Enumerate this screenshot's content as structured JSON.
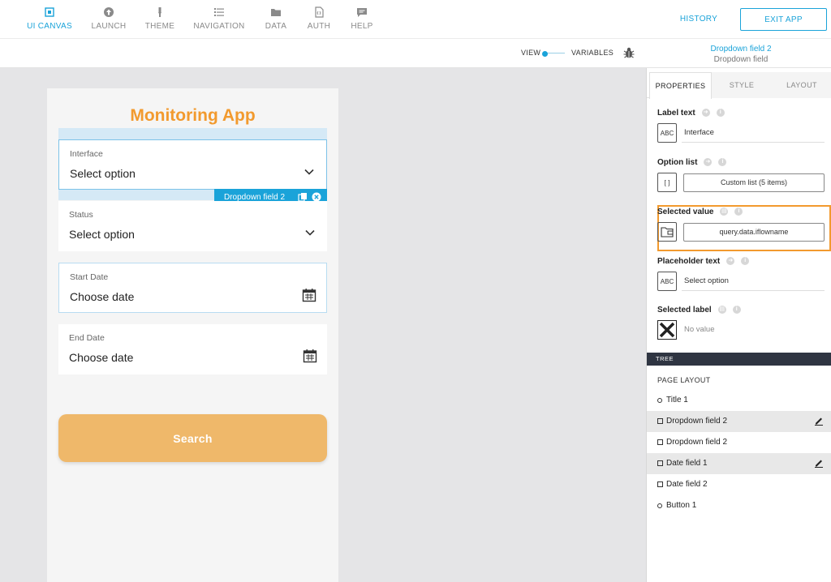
{
  "nav": {
    "items": [
      {
        "label": "UI CANVAS",
        "icon": "canvas-icon",
        "active": true
      },
      {
        "label": "LAUNCH",
        "icon": "launch-icon",
        "active": false
      },
      {
        "label": "THEME",
        "icon": "brush-icon",
        "active": false
      },
      {
        "label": "NAVIGATION",
        "icon": "list-icon",
        "active": false
      },
      {
        "label": "DATA",
        "icon": "folder-icon",
        "active": false
      },
      {
        "label": "AUTH",
        "icon": "document-icon",
        "active": false
      },
      {
        "label": "HELP",
        "icon": "chat-icon",
        "active": false
      }
    ],
    "history": "HISTORY",
    "exit": "EXIT APP"
  },
  "subbar": {
    "view": "VIEW",
    "variables": "VARIABLES",
    "selected_title": "Dropdown field 2",
    "selected_type": "Dropdown field"
  },
  "app": {
    "title": "Monitoring App",
    "fields": [
      {
        "label": "Interface",
        "value": "Select option",
        "icon": "chevron-down-icon"
      },
      {
        "label": "Status",
        "value": "Select option",
        "icon": "chevron-down-icon"
      },
      {
        "label": "Start Date",
        "value": "Choose date",
        "icon": "calendar-icon"
      },
      {
        "label": "End Date",
        "value": "Choose date",
        "icon": "calendar-icon"
      }
    ],
    "selection_tag": "Dropdown field 2",
    "search_button": "Search"
  },
  "panel": {
    "tabs": [
      "PROPERTIES",
      "STYLE",
      "LAYOUT"
    ],
    "active_tab": "PROPERTIES",
    "properties": {
      "label_text": {
        "title": "Label text",
        "value": "Interface",
        "box": "ABC"
      },
      "option_list": {
        "title": "Option list",
        "value": "Custom list (5 items)",
        "box": "[ ]"
      },
      "selected_value": {
        "title": "Selected value",
        "value": "query.data.iflowname"
      },
      "placeholder_text": {
        "title": "Placeholder text",
        "value": "Select option",
        "box": "ABC"
      },
      "selected_label": {
        "title": "Selected label",
        "value": "No value"
      }
    },
    "tree_header": "TREE",
    "page_layout": "PAGE LAYOUT",
    "tree": [
      {
        "label": "Title 1",
        "shape": "circle",
        "highlighted": false,
        "edit": false
      },
      {
        "label": "Dropdown field 2",
        "shape": "square",
        "highlighted": true,
        "edit": true
      },
      {
        "label": "Dropdown field 2",
        "shape": "square",
        "highlighted": false,
        "edit": false
      },
      {
        "label": "Date field 1",
        "shape": "square",
        "highlighted": true,
        "edit": true
      },
      {
        "label": "Date field 2",
        "shape": "square",
        "highlighted": false,
        "edit": false
      },
      {
        "label": "Button 1",
        "shape": "circle",
        "highlighted": false,
        "edit": false
      }
    ]
  },
  "colors": {
    "accent": "#1aa3d9",
    "brand_orange": "#f29a2e",
    "button": "#efb86a",
    "tree_header": "#2f3542"
  }
}
